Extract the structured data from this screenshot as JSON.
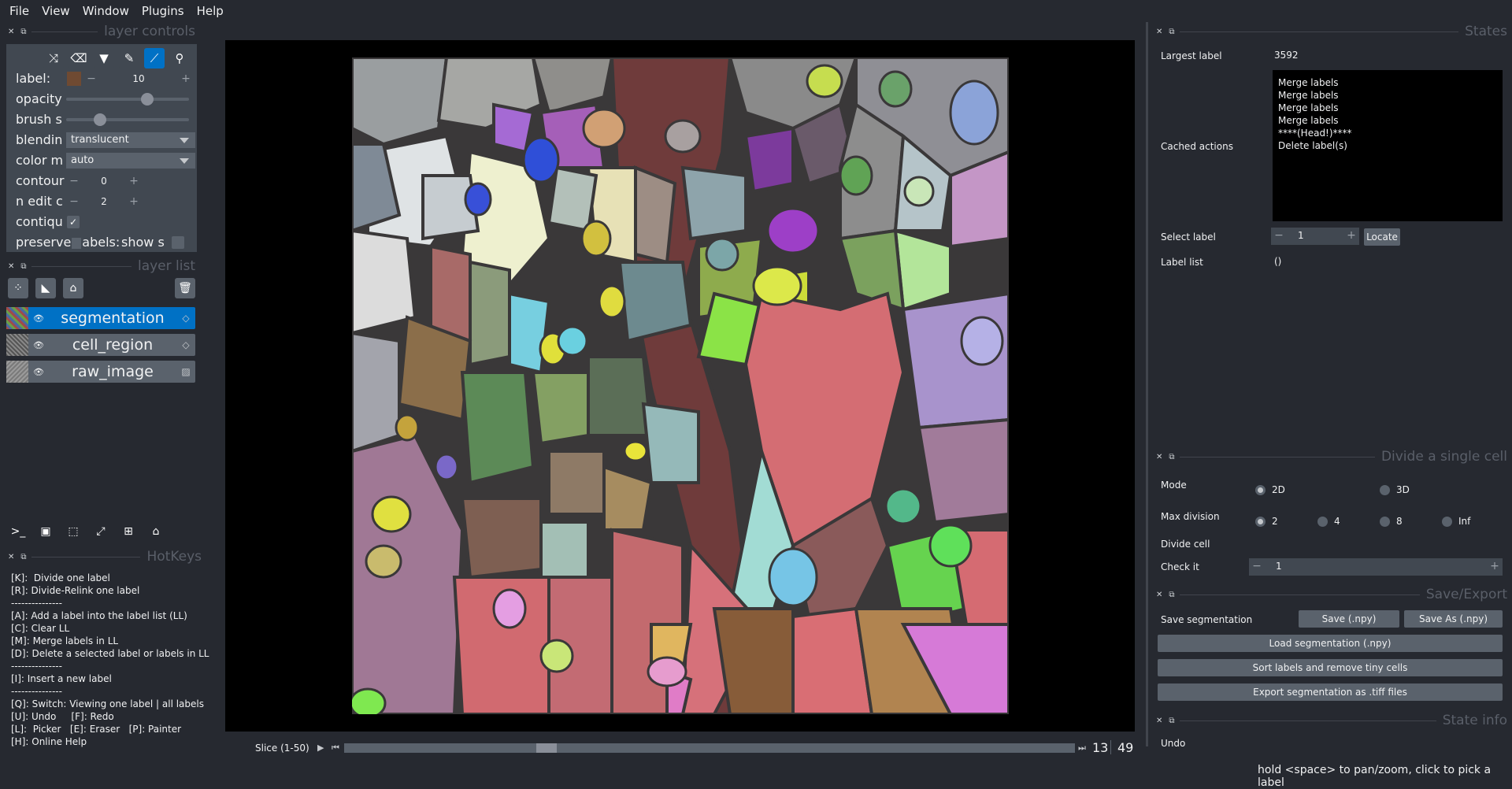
{
  "menu": [
    "File",
    "View",
    "Window",
    "Plugins",
    "Help"
  ],
  "layer_controls": {
    "title": "layer controls",
    "label_text": "label:",
    "label_value": "10",
    "opacity_text": "opacity",
    "opacity_level": 0.68,
    "brush_text": "brush s",
    "brush_level": 0.25,
    "blending_text": "blendin",
    "blending_value": "translucent",
    "colormode_text": "color m",
    "colormode_value": "auto",
    "contour_text": "contour",
    "contour_value": "0",
    "nedit_text": "n edit c",
    "nedit_value": "2",
    "contiguous_text": "contiqu",
    "preserve_text": "preserve labels:",
    "preserve_visible": "preserve",
    "preserve_rest": "abels:",
    "show_text": "show s",
    "label_color": "#6f4a32"
  },
  "layer_list": {
    "title": "layer list",
    "layers": [
      {
        "name": "segmentation",
        "selected": true
      },
      {
        "name": "cell_region",
        "selected": false
      },
      {
        "name": "raw_image",
        "selected": false
      }
    ]
  },
  "hotkeys": {
    "title": "HotKeys",
    "lines": [
      "[K]:  Divide one label",
      "[R]: Divide-Relink one label",
      "---------------",
      "[A]: Add a label into the label list (LL)",
      "[C]: Clear LL",
      "[M]: Merge labels in LL",
      "[D]: Delete a selected label or labels in LL",
      "---------------",
      "[I]: Insert a new label",
      "---------------",
      "[Q]: Switch: Viewing one label | all labels",
      "[U]: Undo     [F]: Redo",
      "[L]:  Picker   [E]: Eraser   [P]: Painter",
      "[H]: Online Help"
    ]
  },
  "states": {
    "title": "States",
    "largest_label_text": "Largest label",
    "largest_label_value": "3592",
    "cached_actions_text": "Cached actions",
    "cached_actions": [
      "Merge labels",
      "Merge labels",
      "Merge labels",
      "Merge labels",
      "****(Head!)****",
      "Delete label(s)"
    ],
    "select_label_text": "Select label",
    "select_label_value": "1",
    "locate_text": "Locate",
    "label_list_text": "Label list",
    "label_list_value": "()"
  },
  "divide": {
    "title": "Divide a single cell",
    "mode_text": "Mode",
    "mode_opts": [
      "2D",
      "3D"
    ],
    "maxdiv_text": "Max division",
    "maxdiv_opts": [
      "2",
      "4",
      "8",
      "Inf"
    ],
    "divide_cell_text": "Divide cell",
    "check_it_text": "Check it",
    "check_it_value": "1"
  },
  "save_export": {
    "title": "Save/Export",
    "save_seg_text": "Save segmentation",
    "save_btn": "Save (.npy)",
    "save_as_btn": "Save As (.npy)",
    "load_btn": "Load segmentation (.npy)",
    "sort_btn": "Sort labels and remove tiny cells",
    "export_btn": "Export segmentation as .tiff files"
  },
  "state_info": {
    "title": "State info",
    "value": "Undo"
  },
  "slice": {
    "text": "Slice (1-50)",
    "current": "13",
    "total": "49",
    "position": 0.27
  },
  "status_text": "hold <space> to pan/zoom, click to pick a label",
  "colors": {
    "bg": "#262930",
    "panel": "#414851",
    "accent": "#0071c5"
  }
}
